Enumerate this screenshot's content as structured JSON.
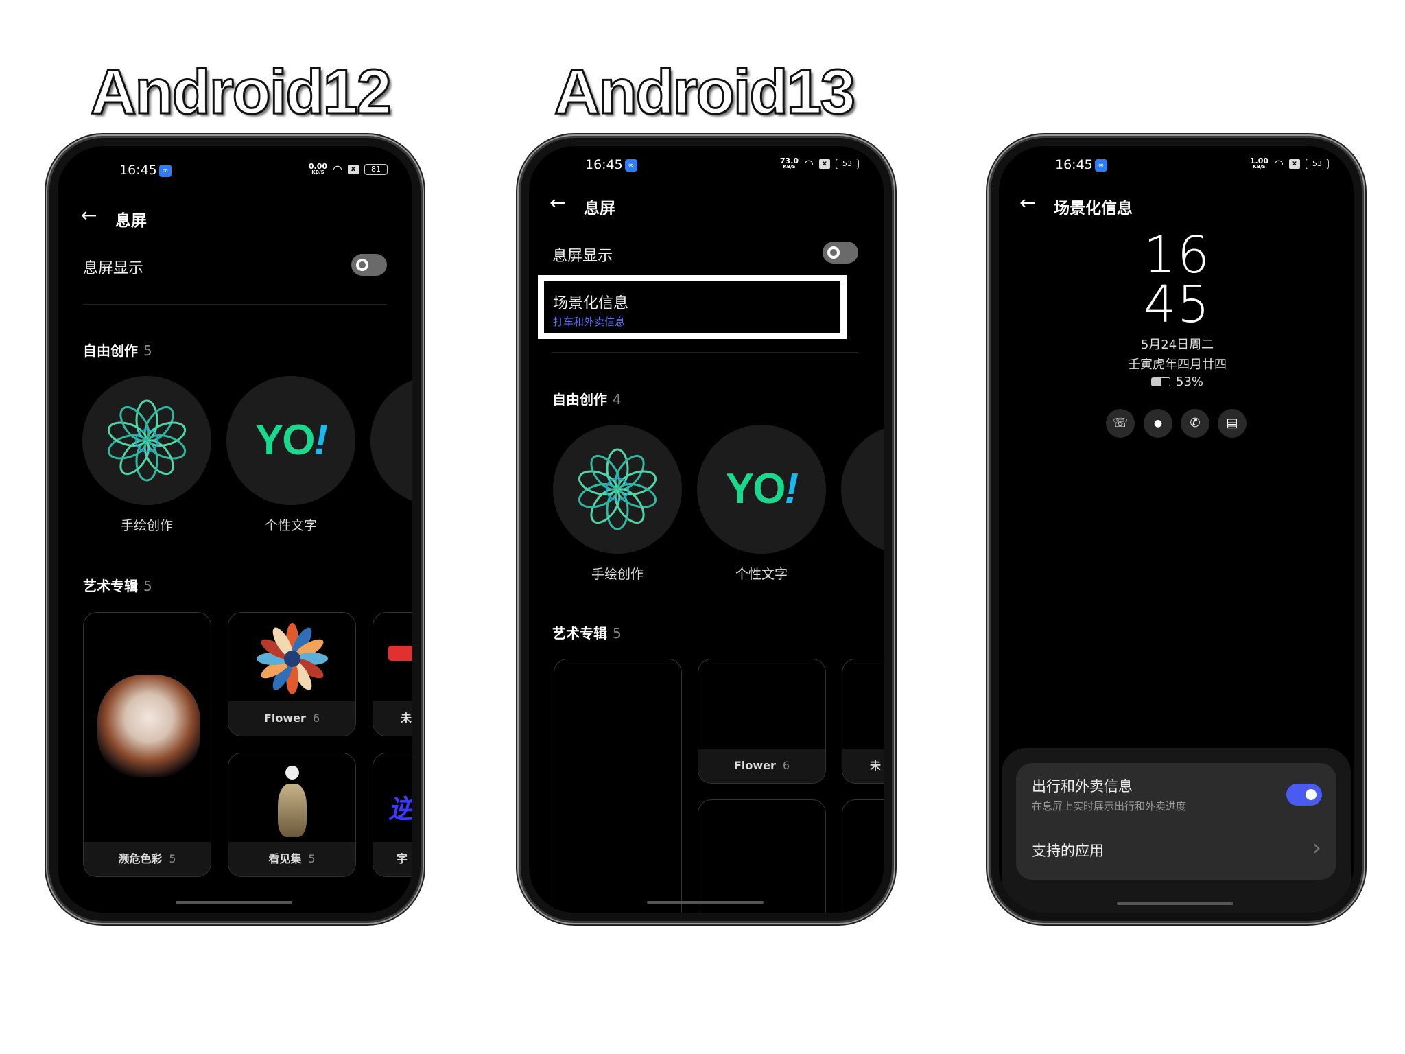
{
  "headings": [
    "Android12",
    "Android13"
  ],
  "colors": {
    "accent_blue": "#4a5cf0",
    "subtitle_blue": "#5b6df5",
    "yo_green": "#19d98c",
    "yo_blue": "#1ab9f0"
  },
  "phone1": {
    "status": {
      "time": "16:45",
      "speed": "0.00",
      "speed_unit": "KB/S",
      "battery": "81"
    },
    "title": "息屏",
    "aod_label": "息屏显示",
    "free_section": {
      "title": "自由创作",
      "count": "5",
      "items": [
        "手绘创作",
        "个性文字"
      ]
    },
    "art_section": {
      "title": "艺术专辑",
      "count": "5",
      "cards": [
        {
          "name": "濒危色彩",
          "count": "5"
        },
        {
          "name": "Flower",
          "count": "6"
        },
        {
          "name": "看见集",
          "count": "5"
        },
        {
          "name": "未",
          "count": ""
        },
        {
          "name": "字",
          "count": ""
        }
      ]
    }
  },
  "phone2": {
    "status": {
      "time": "16:45",
      "speed": "73.0",
      "speed_unit": "KB/S",
      "battery": "53"
    },
    "title": "息屏",
    "aod_label": "息屏显示",
    "scene": {
      "title": "场景化信息",
      "subtitle": "打车和外卖信息"
    },
    "free_section": {
      "title": "自由创作",
      "count": "4",
      "items": [
        "手绘创作",
        "个性文字"
      ]
    },
    "art_section": {
      "title": "艺术专辑",
      "count": "5",
      "cards": [
        {
          "name": "Flower",
          "count": "6"
        },
        {
          "name": "未",
          "count": ""
        }
      ]
    }
  },
  "phone3": {
    "status": {
      "time": "16:45",
      "speed": "1.00",
      "speed_unit": "KB/S",
      "battery": "53"
    },
    "title": "场景化信息",
    "clock": {
      "hour": "16",
      "minute": "45",
      "date": "5月24日周二",
      "lunar": "壬寅虎年四月廿四",
      "battery": "53%"
    },
    "notif_icons": [
      "ride-hailing-icon",
      "qq-icon",
      "wechat-icon",
      "message-icon"
    ],
    "setting": {
      "title": "出行和外卖信息",
      "subtitle": "在息屏上实时展示出行和外卖进度",
      "enabled": true
    },
    "apps_label": "支持的应用"
  },
  "glyphs": {
    "back": "←",
    "chevron": "›",
    "yo": "YO",
    "bang": "!",
    "x": "x",
    "cloud": "∞",
    "phone": "☏",
    "qq": "🔔",
    "wechat": "✆",
    "msg": "▤"
  }
}
